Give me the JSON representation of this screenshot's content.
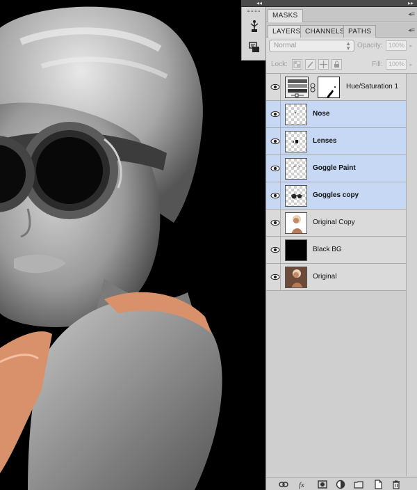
{
  "panels": {
    "masks_tab": "MASKS",
    "tabs": [
      {
        "label": "LAYERS",
        "active": true
      },
      {
        "label": "CHANNELS",
        "active": false
      },
      {
        "label": "PATHS",
        "active": false
      }
    ],
    "blend_mode": "Normal",
    "opacity_label": "Opacity:",
    "opacity_value": "100%",
    "lock_label": "Lock:",
    "fill_label": "Fill:",
    "fill_value": "100%"
  },
  "layers": [
    {
      "name": "Hue/Saturation 1",
      "thumb": "adjustment",
      "selected": false,
      "visible": true
    },
    {
      "name": "Nose",
      "thumb": "transparent",
      "selected": true,
      "visible": true
    },
    {
      "name": "Lenses",
      "thumb": "transparent",
      "selected": true,
      "visible": true
    },
    {
      "name": "Goggle Paint",
      "thumb": "transparent",
      "selected": true,
      "visible": true
    },
    {
      "name": "Goggles copy",
      "thumb": "transparent",
      "selected": true,
      "visible": true
    },
    {
      "name": "Original Copy",
      "thumb": "photo",
      "selected": false,
      "visible": true
    },
    {
      "name": "Black BG",
      "thumb": "black",
      "selected": false,
      "visible": true
    },
    {
      "name": "Original",
      "thumb": "photo",
      "selected": false,
      "visible": true
    }
  ],
  "icons": {
    "dock": [
      "puppet-tool-icon",
      "clone-source-icon"
    ],
    "bottom": [
      "link-layers-icon",
      "fx-icon",
      "add-mask-icon",
      "adjustment-layer-icon",
      "new-group-icon",
      "new-layer-icon",
      "trash-icon"
    ]
  },
  "colors": {
    "selected_row": "#c6d8f3",
    "panel_bg": "#cfcfcf",
    "canvas_bg": "#000000",
    "skin_tint": "#d8916a"
  }
}
